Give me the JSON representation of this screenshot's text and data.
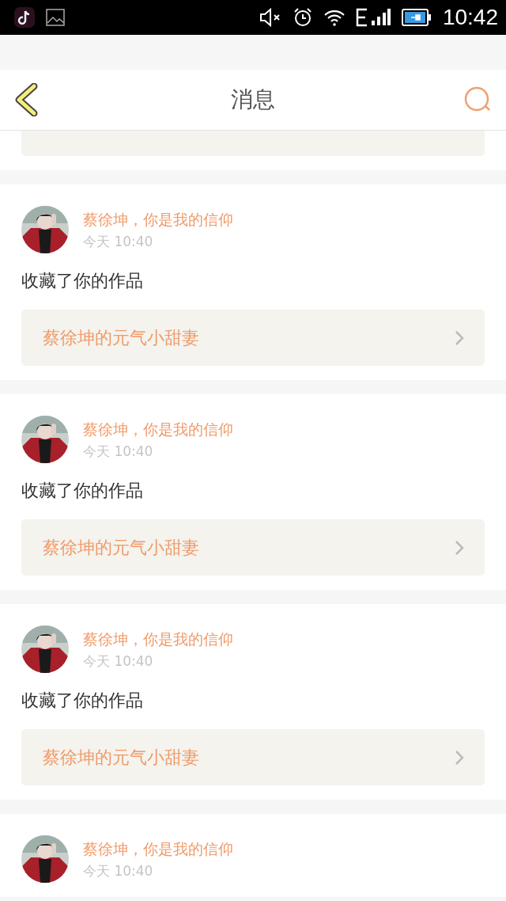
{
  "status_bar": {
    "time": "10:42"
  },
  "header": {
    "title": "消息"
  },
  "messages": [
    {
      "user": "蔡徐坤，你是我的信仰",
      "time": "今天 10:40",
      "action": "收藏了你的作品",
      "work": "蔡徐坤的元气小甜妻"
    },
    {
      "user": "蔡徐坤，你是我的信仰",
      "time": "今天 10:40",
      "action": "收藏了你的作品",
      "work": "蔡徐坤的元气小甜妻"
    },
    {
      "user": "蔡徐坤，你是我的信仰",
      "time": "今天 10:40",
      "action": "收藏了你的作品",
      "work": "蔡徐坤的元气小甜妻"
    },
    {
      "user": "蔡徐坤，你是我的信仰",
      "time": "今天 10:40"
    }
  ]
}
